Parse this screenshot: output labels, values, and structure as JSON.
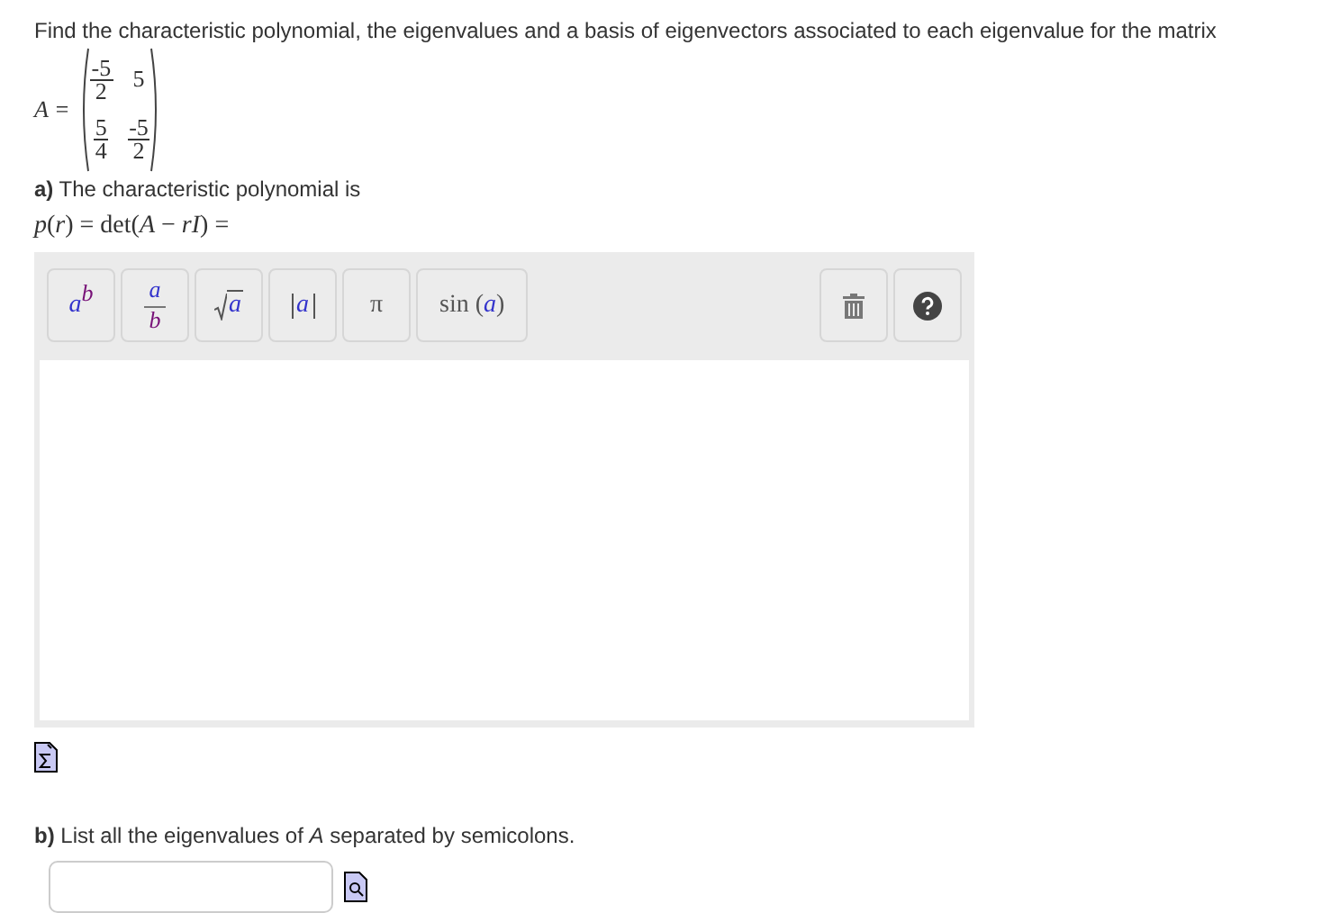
{
  "prompt": "Find the characteristic polynomial, the eigenvalues and a basis of eigenvectors associated to each eigenvalue for the matrix",
  "matrix": {
    "name": "A =",
    "rows": [
      [
        {
          "kind": "fraction",
          "num": "-5",
          "den": "2"
        },
        {
          "kind": "number",
          "value": "5"
        }
      ],
      [
        {
          "kind": "fraction",
          "num": "5",
          "den": "4"
        },
        {
          "kind": "fraction",
          "num": "-5",
          "den": "2"
        }
      ]
    ]
  },
  "part_a": {
    "label": "**a)** The characteristic polynomial is",
    "formula": "*p*(*r*) = det(*A* − *rI*) ="
  },
  "toolbar": [
    {
      "kind": "power",
      "base": "a",
      "exponent": "b"
    },
    {
      "kind": "fraction",
      "numerator": "a",
      "denominator": "b"
    },
    {
      "kind": "sqrt",
      "radicand": "a"
    },
    {
      "kind": "abs",
      "arg": "a"
    },
    {
      "kind": "symbol",
      "text": "π"
    },
    {
      "kind": "function",
      "prefix": "sin (",
      "arg": "a",
      "suffix": ")"
    }
  ],
  "part_b": {
    "label": "**b)** List all the eigenvalues of *A* separated by semicolons."
  }
}
